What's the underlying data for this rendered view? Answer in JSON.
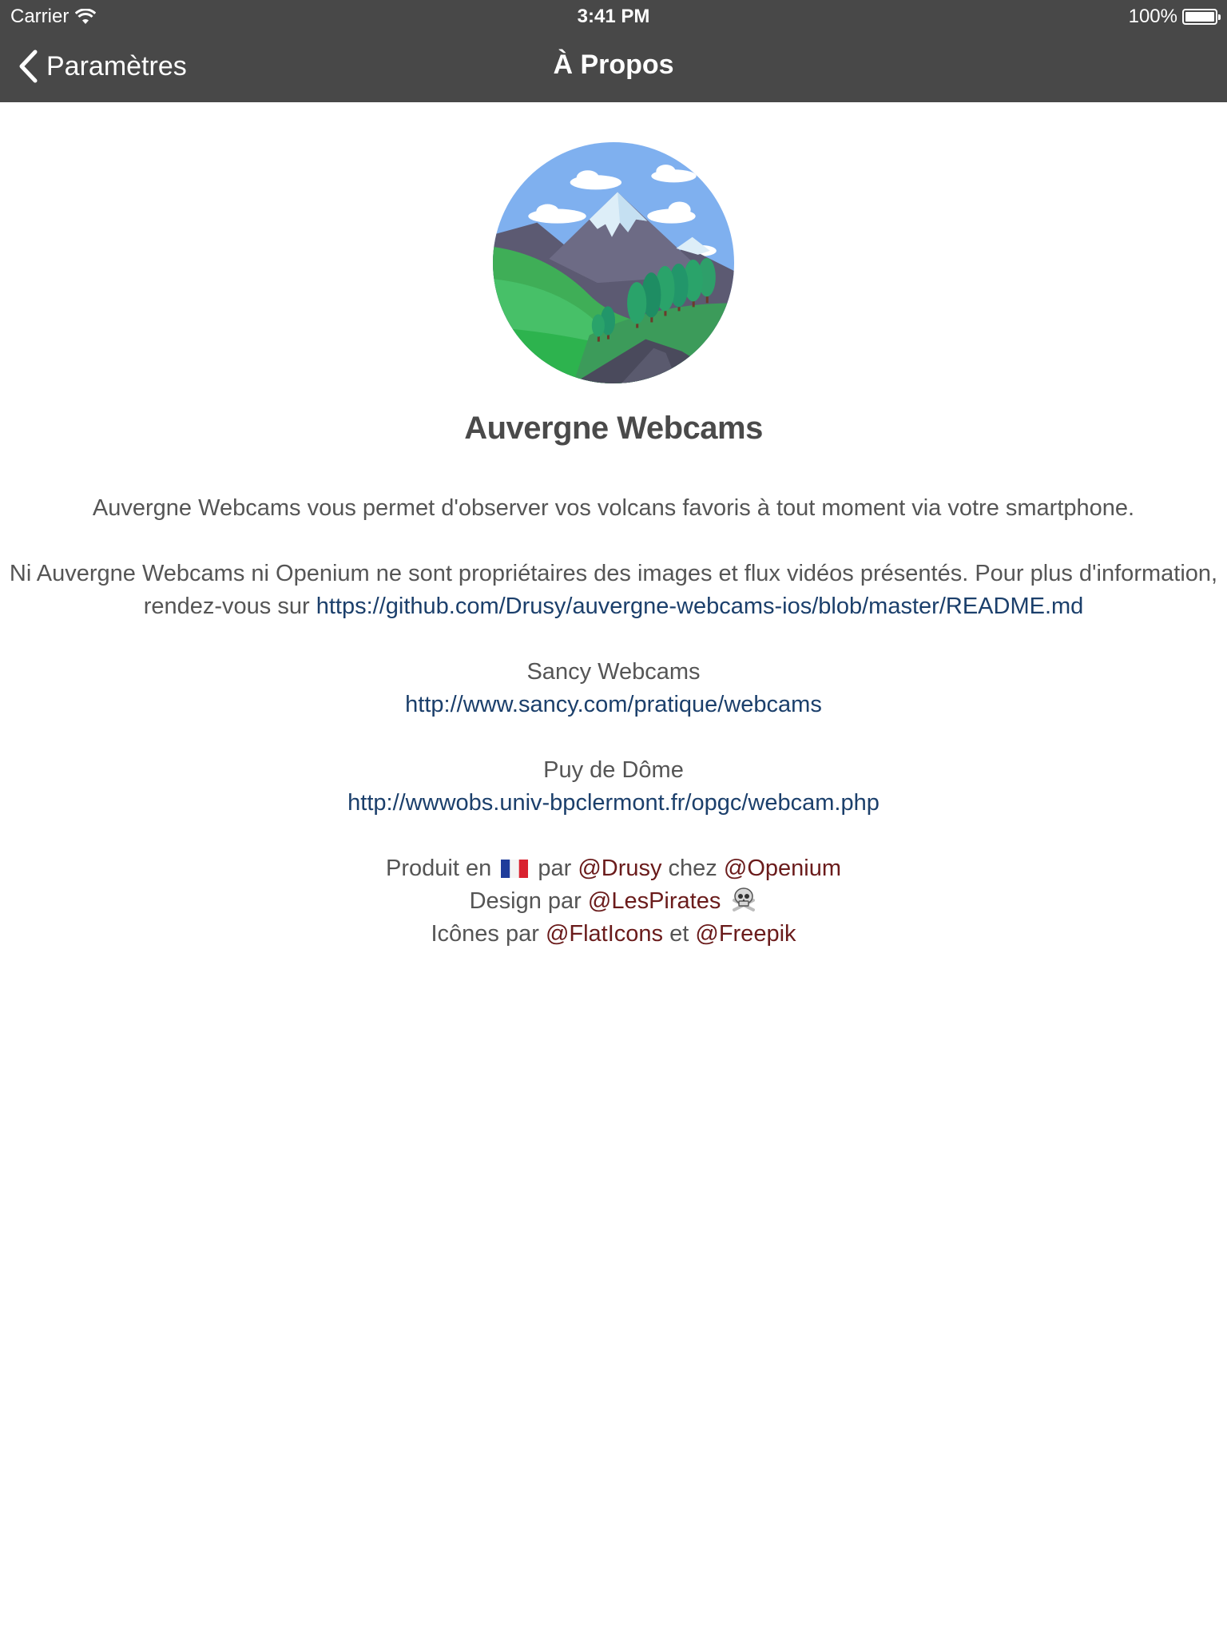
{
  "status_bar": {
    "carrier": "Carrier",
    "time": "3:41 PM",
    "battery": "100%"
  },
  "nav": {
    "back_label": "Paramètres",
    "title": "À Propos"
  },
  "app": {
    "name": "Auvergne Webcams"
  },
  "content": {
    "intro": "Auvergne Webcams vous permet d'observer vos volcans favoris à tout moment via votre smartphone.",
    "disclaimer": "Ni Auvergne Webcams ni Openium ne sont propriétaires des images et flux vidéos présentés. Pour plus d'information, rendez-vous sur",
    "readme_link": "https://github.com/Drusy/auvergne-webcams-ios/blob/master/README.md",
    "sancy_title": "Sancy Webcams",
    "sancy_link": "http://www.sancy.com/pratique/webcams",
    "puy_title": "Puy de Dôme",
    "puy_link": "http://wwwobs.univ-bpclermont.fr/opgc/webcam.php"
  },
  "credits": {
    "produced_prefix": "Produit en",
    "produced_par": "par",
    "drusy": "@Drusy",
    "chez": "chez",
    "openium": "@Openium",
    "design_prefix": "Design par",
    "lespirates": "@LesPirates",
    "icons_prefix": "Icônes par",
    "flaticons": "@FlatIcons",
    "et": "et",
    "freepik": "@Freepik"
  },
  "colors": {
    "nav_bg": "#484848",
    "link": "#1b3f6b",
    "handle": "#6a1b1b",
    "text": "#555555"
  }
}
